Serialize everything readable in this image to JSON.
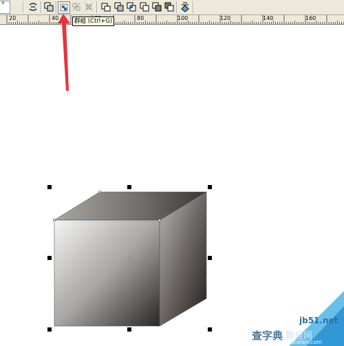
{
  "toolbar": {
    "field_value": "°",
    "buttons": [
      {
        "name": "weld-button",
        "icon": "weld-icon"
      },
      {
        "name": "intersect-button",
        "icon": "intersect-icon"
      },
      {
        "name": "group-button",
        "icon": "group-icon"
      },
      {
        "name": "ungroup-button",
        "icon": "ungroup-icon"
      },
      {
        "name": "ungroup-all-button",
        "icon": "ungroup-all-icon"
      },
      {
        "name": "combine-button",
        "icon": "combine-icon"
      },
      {
        "name": "break-apart-button",
        "icon": "break-apart-icon"
      },
      {
        "name": "trim-button",
        "icon": "trim-icon"
      },
      {
        "name": "simplify-button",
        "icon": "simplify-icon"
      },
      {
        "name": "front-minus-back-button",
        "icon": "front-minus-back-icon"
      },
      {
        "name": "back-minus-front-button",
        "icon": "back-minus-front-icon"
      },
      {
        "name": "create-boundary-button",
        "icon": "create-boundary-icon"
      }
    ]
  },
  "ruler": {
    "labels": [
      "20",
      "40",
      "60",
      "80",
      "100",
      "120",
      "140",
      "160"
    ]
  },
  "tooltip": {
    "text": "群組 (Ctrl+G)"
  },
  "colors": {
    "annotation_arrow": "#e8323c",
    "selection_handle": "#000000",
    "toolbar_bg": "#ece9d8",
    "tooltip_bg": "#ffffe1"
  },
  "watermark": {
    "line1": "查字典",
    "line2": "教程网",
    "line3": "jb51.net",
    "line4": "jiaocheng.chazidian.com"
  }
}
